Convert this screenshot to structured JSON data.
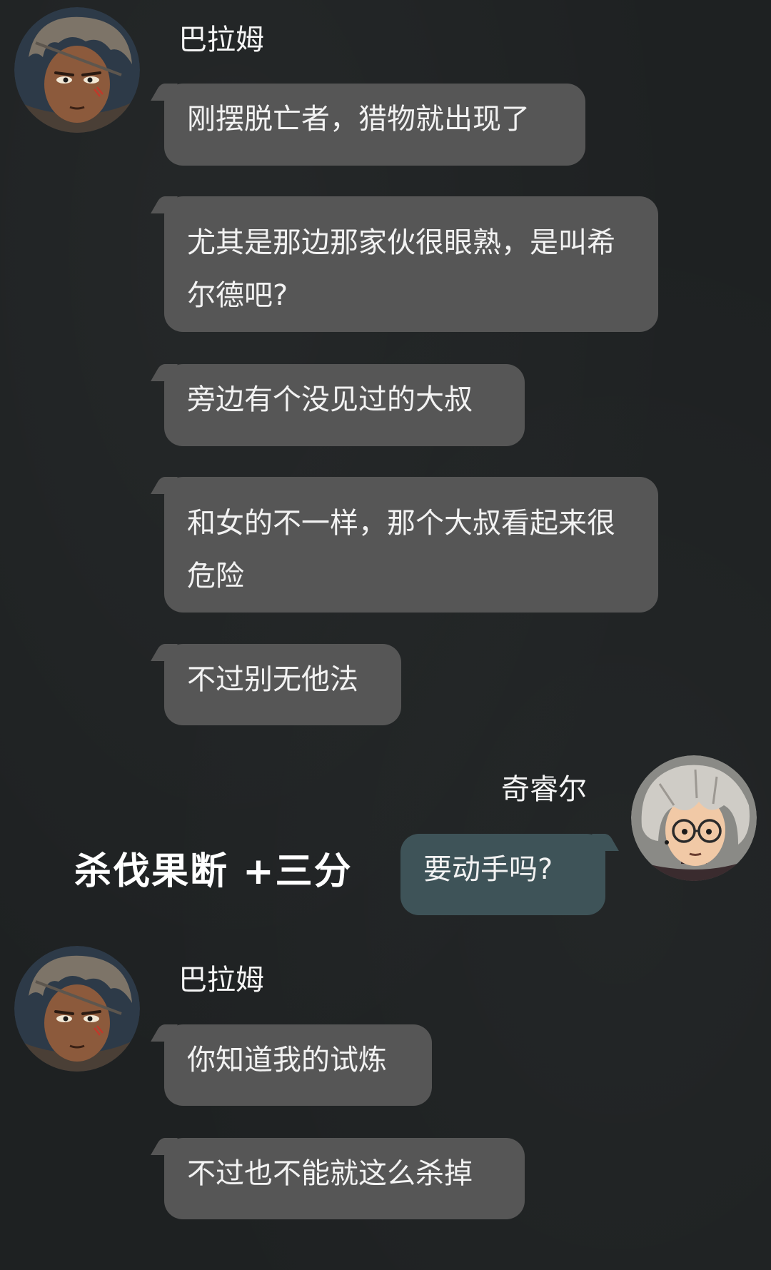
{
  "messages": [
    {
      "sender": "巴拉姆",
      "text": "刚摆脱亡者，猎物就出现了"
    },
    {
      "sender": "巴拉姆",
      "text": "尤其是那边那家伙很眼熟，是叫希尔德吧?"
    },
    {
      "sender": "巴拉姆",
      "text": "旁边有个没见过的大叔"
    },
    {
      "sender": "巴拉姆",
      "text": "和女的不一样，那个大叔看起来很危险"
    },
    {
      "sender": "巴拉姆",
      "text": "不过别无他法"
    },
    {
      "sender": "奇睿尔",
      "text": "要动手吗?"
    },
    {
      "sender": "巴拉姆",
      "text": "你知道我的试炼"
    },
    {
      "sender": "巴拉姆",
      "text": "不过也不能就这么杀掉"
    }
  ],
  "senders": {
    "balam": "巴拉姆",
    "player": "奇睿尔"
  },
  "reward": {
    "text": "杀伐果断 +三分"
  },
  "colors": {
    "background": "#1e2122",
    "incoming_bubble": "#565656",
    "outgoing_bubble": "#3e5358"
  }
}
